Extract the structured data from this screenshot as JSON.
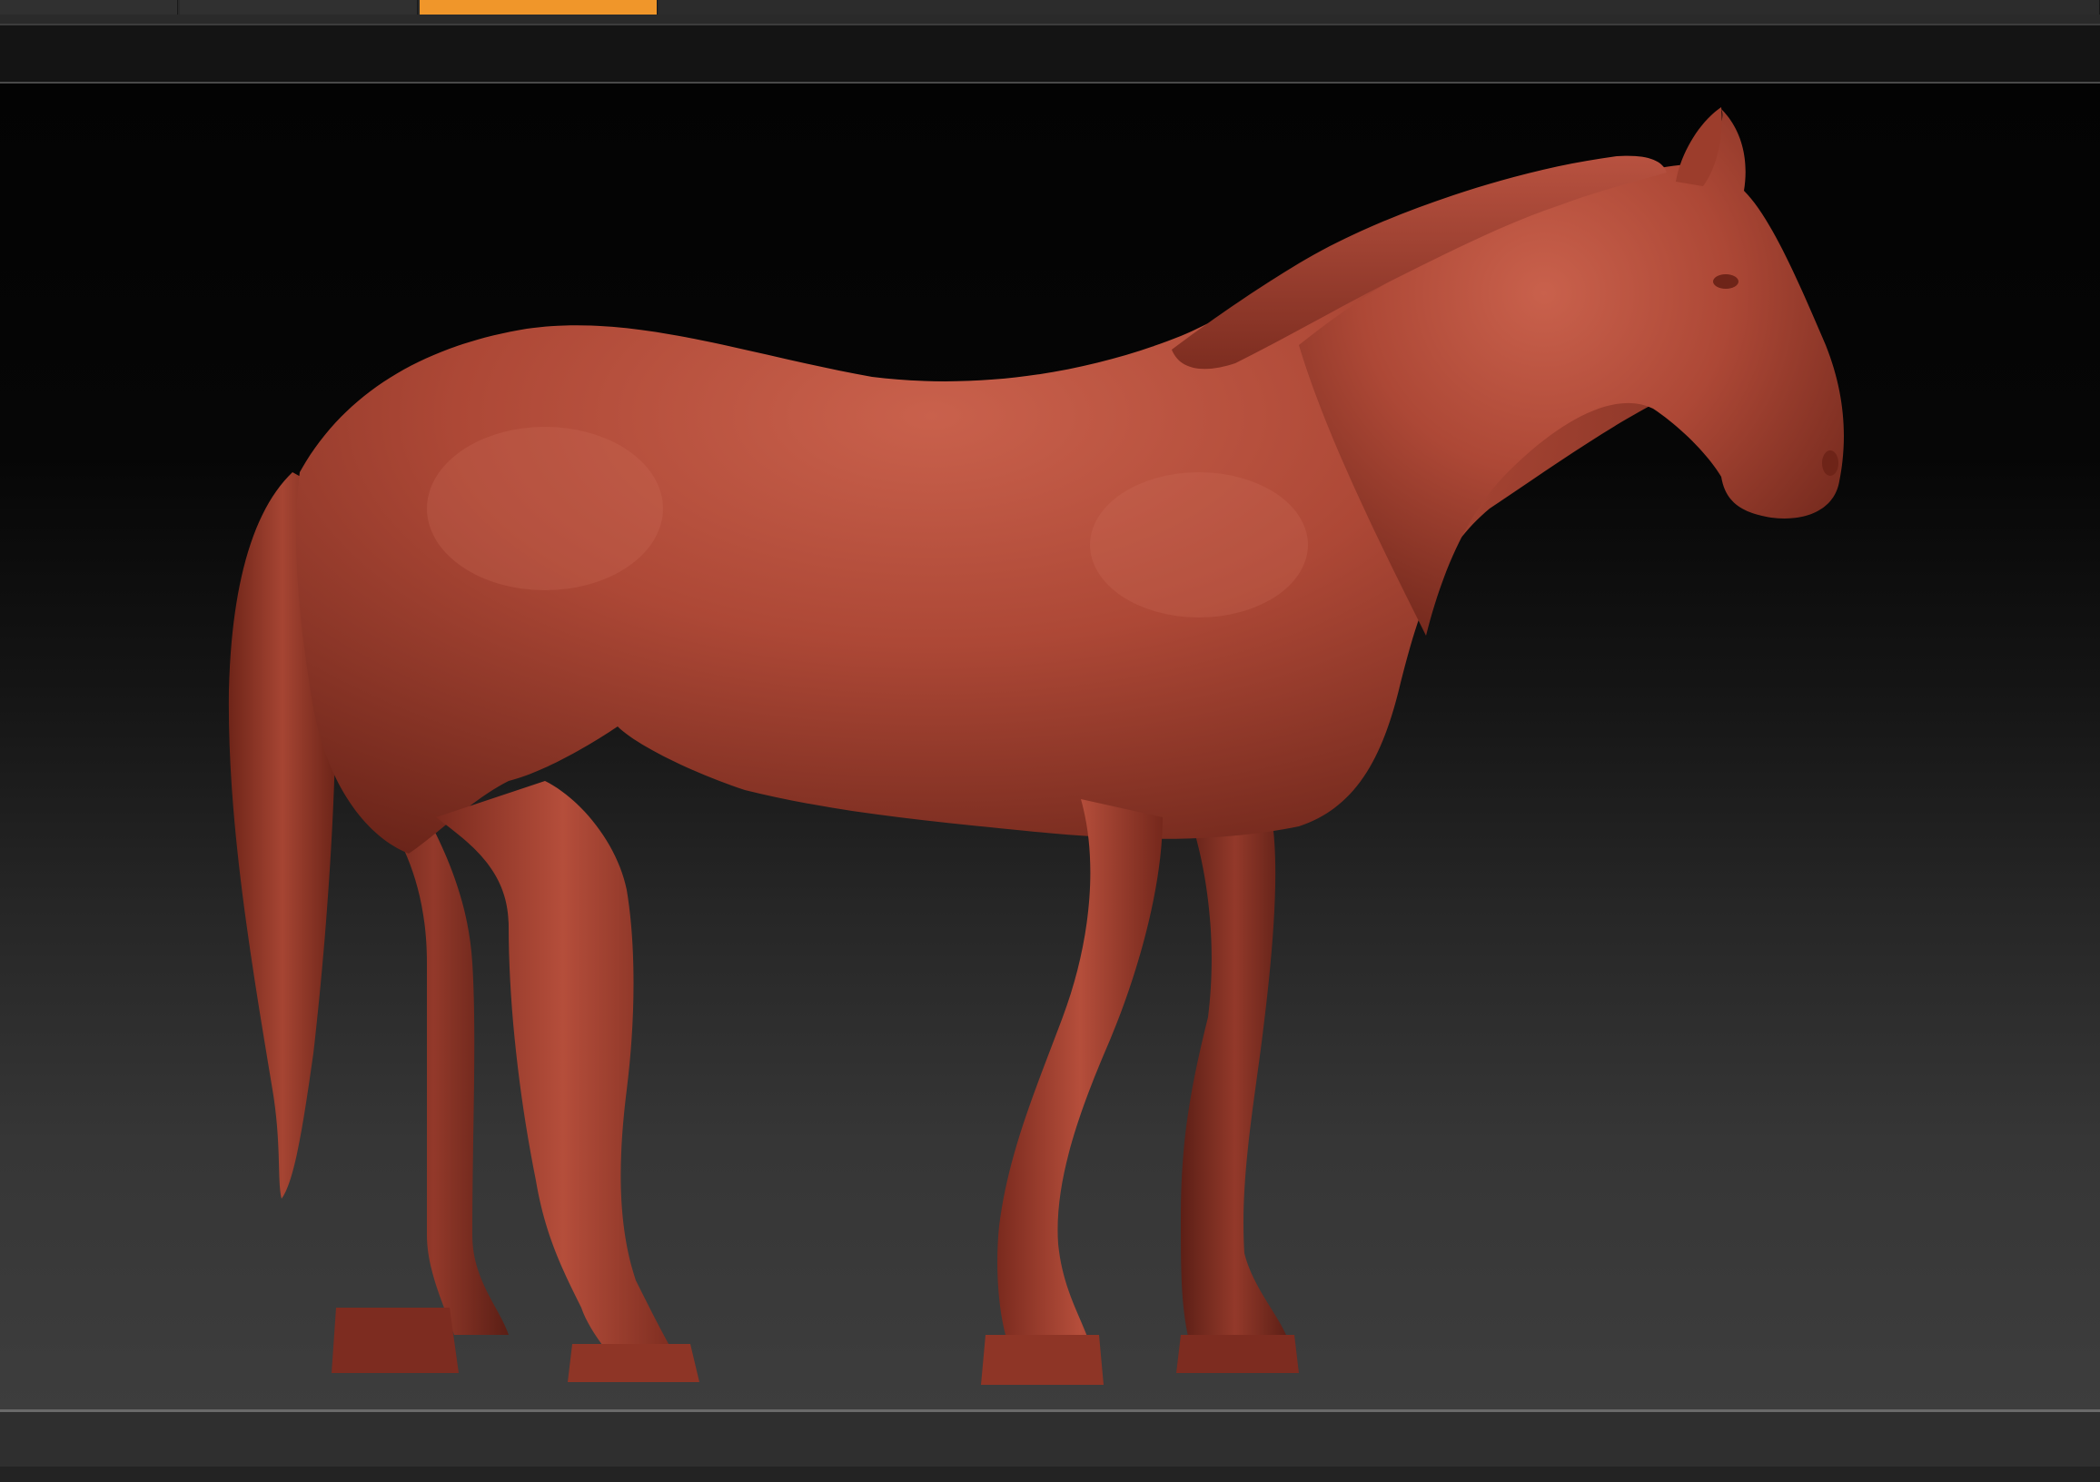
{
  "tabs": [
    {
      "id": "tab-1",
      "active": false
    },
    {
      "id": "tab-2",
      "active": false
    },
    {
      "id": "tab-3",
      "active": true
    },
    {
      "id": "tab-4",
      "active": false
    }
  ],
  "canvas": {
    "model": "horse-sculpt",
    "material_color": "#a8412f"
  },
  "colors": {
    "accent": "#f0962a",
    "background_top": "#030303",
    "background_bottom": "#3d3d3d",
    "ui_panel": "#2f2f2f"
  }
}
